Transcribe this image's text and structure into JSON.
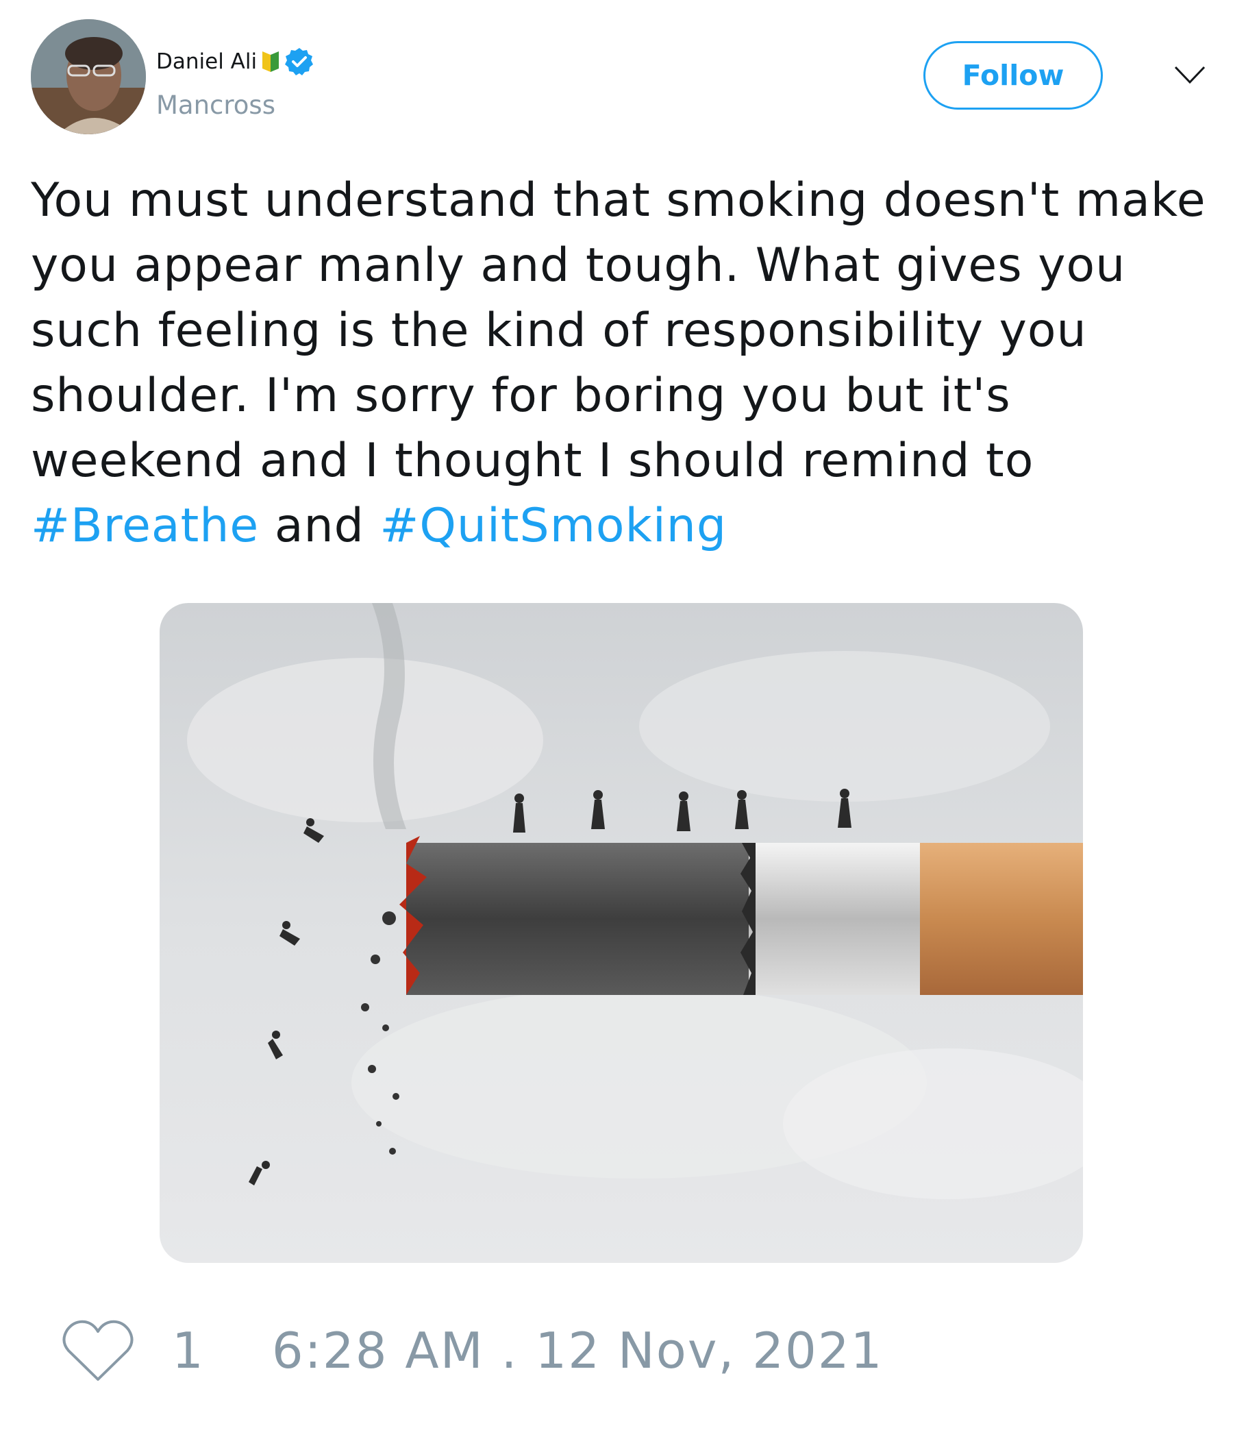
{
  "tweet": {
    "author": {
      "display_name": "Daniel Ali",
      "handle": "Mancross",
      "verified": true
    },
    "follow_label": "Follow",
    "text": {
      "line1": "You must understand that smoking doesn't make",
      "line2": "you appear manly and tough. What gives you",
      "line3": "such feeling is the kind of responsibility you",
      "line4": "shoulder. I'm sorry for boring you but it's",
      "line5": "weekend and I thought I should remind to",
      "hashtag1": "#Breathe",
      "conjunction": " and ",
      "hashtag2": "#QuitSmoking"
    },
    "likes": "1",
    "timestamp": "6:28 AM . 12 Nov, 2021"
  },
  "colors": {
    "accent": "#1da1f2",
    "muted": "#8899a6",
    "text": "#14171a"
  },
  "icons": [
    "flag-badge-icon",
    "verified-badge-icon",
    "chevron-down-icon",
    "heart-icon"
  ]
}
